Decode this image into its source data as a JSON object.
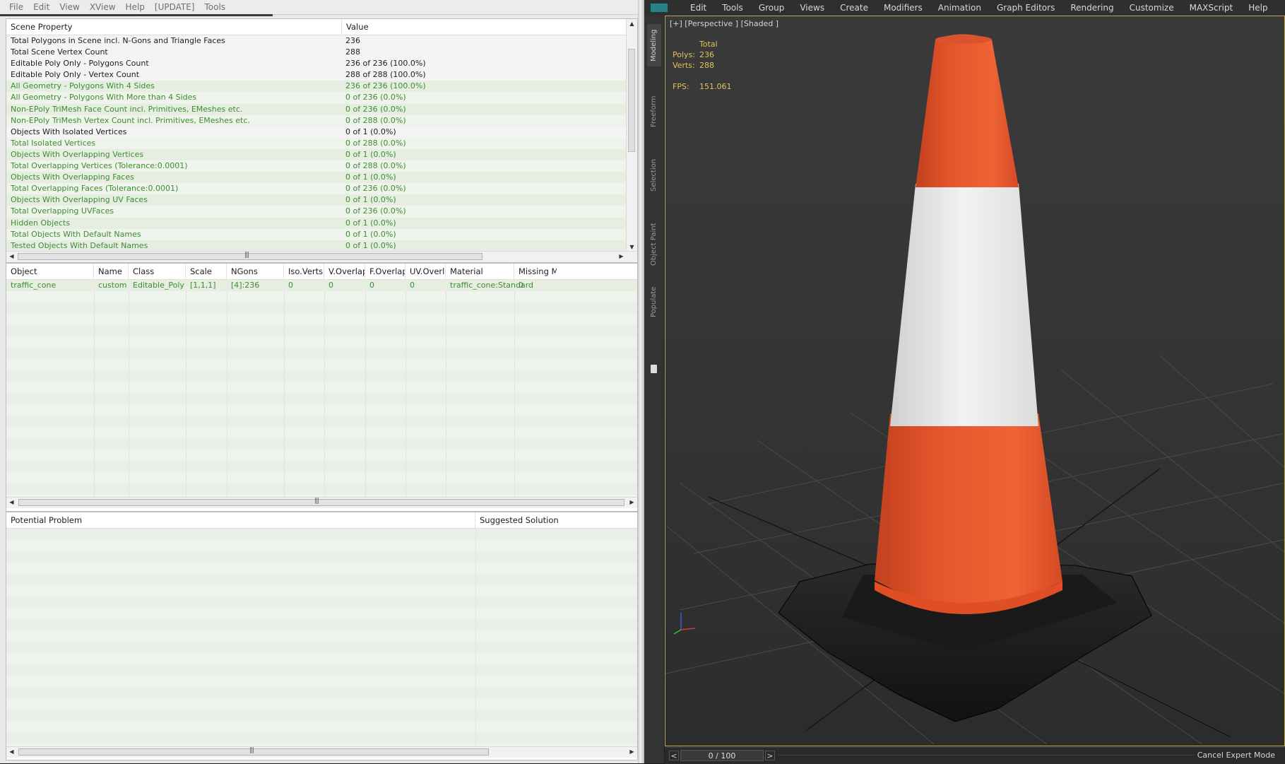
{
  "xview": {
    "menu": [
      "File",
      "Edit",
      "View",
      "XView",
      "Help",
      "[UPDATE]",
      "Tools"
    ],
    "scene_header": [
      "Scene Property",
      "Value"
    ],
    "scene_rows": [
      {
        "property": "Total Polygons in Scene incl. N-Gons and Triangle Faces",
        "value": "236",
        "status": "ok"
      },
      {
        "property": "Total Scene Vertex Count",
        "value": "288",
        "status": "ok"
      },
      {
        "property": "Editable Poly Only - Polygons Count",
        "value": "236 of 236 (100.0%)",
        "status": "ok"
      },
      {
        "property": "Editable Poly Only - Vertex Count",
        "value": "288 of 288 (100.0%)",
        "status": "ok"
      },
      {
        "property": "All Geometry - Polygons With 4 Sides",
        "value": "236 of 236 (100.0%)",
        "status": "warn"
      },
      {
        "property": "All Geometry - Polygons With More than 4 Sides",
        "value": "0 of 236 (0.0%)",
        "status": "warn"
      },
      {
        "property": "Non-EPoly TriMesh Face Count incl. Primitives, EMeshes etc.",
        "value": "0 of 236 (0.0%)",
        "status": "warn"
      },
      {
        "property": "Non-EPoly TriMesh Vertex Count incl. Primitives, EMeshes etc.",
        "value": "0 of 288 (0.0%)",
        "status": "warn"
      },
      {
        "property": "Objects With Isolated Vertices",
        "value": "0 of 1 (0.0%)",
        "status": "ok"
      },
      {
        "property": "Total Isolated Vertices",
        "value": "0 of 288 (0.0%)",
        "status": "warn"
      },
      {
        "property": "Objects With Overlapping Vertices",
        "value": "0 of 1 (0.0%)",
        "status": "warn"
      },
      {
        "property": "Total Overlapping Vertices (Tolerance:0.0001)",
        "value": "0 of 288 (0.0%)",
        "status": "warn"
      },
      {
        "property": "Objects With Overlapping Faces",
        "value": "0 of 1 (0.0%)",
        "status": "warn"
      },
      {
        "property": "Total Overlapping Faces (Tolerance:0.0001)",
        "value": "0 of 236 (0.0%)",
        "status": "warn"
      },
      {
        "property": "Objects With Overlapping UV Faces",
        "value": "0 of 1 (0.0%)",
        "status": "warn"
      },
      {
        "property": "Total Overlapping UVFaces",
        "value": "0 of 236 (0.0%)",
        "status": "warn"
      },
      {
        "property": "Hidden Objects",
        "value": "0 of 1 (0.0%)",
        "status": "warn"
      },
      {
        "property": "Total Objects With Default Names",
        "value": "0 of 1 (0.0%)",
        "status": "warn"
      },
      {
        "property": "Tested Objects With Default Names",
        "value": "0 of 1 (0.0%)",
        "status": "warn"
      }
    ],
    "object_header": [
      "Object",
      "Name",
      "Class",
      "Scale",
      "NGons",
      "Iso.Verts",
      "V.Overlap",
      "F.Overlap",
      "UV.Overlap",
      "Material",
      "Missing M..."
    ],
    "object_rows": [
      [
        "traffic_cone",
        "custom",
        "Editable_Poly",
        "[1,1,1]",
        "[4]:236",
        "0",
        "0",
        "0",
        "0",
        "traffic_cone:Standard",
        "0"
      ]
    ],
    "problem_header": [
      "Potential Problem",
      "Suggested Solution"
    ],
    "colors": {
      "ok_text": "#1e1e1e",
      "warn_text": "#3c8d2e",
      "row_green": "#e6eee2"
    }
  },
  "max": {
    "menu": [
      "Edit",
      "Tools",
      "Group",
      "Views",
      "Create",
      "Modifiers",
      "Animation",
      "Graph Editors",
      "Rendering",
      "Customize",
      "MAXScript",
      "Help"
    ],
    "ribbon_tabs": [
      "Modeling",
      "Freeform",
      "Selection",
      "Object Paint",
      "Populate"
    ],
    "viewport_label": "[+] [Perspective ] [Shaded ]",
    "stats": {
      "title": "Total",
      "polys_label": "Polys:",
      "polys": "236",
      "verts_label": "Verts:",
      "verts": "288",
      "fps_label": "FPS:",
      "fps": "151.061"
    },
    "timeline": {
      "prev": "<",
      "frame": "0 / 100",
      "next": ">"
    },
    "cancel_expert": "Cancel Expert Mode",
    "colors": {
      "cone_orange": "#e4542c",
      "cone_white": "#ececec",
      "base": "#1c1c1c",
      "stats_text": "#e1c35b",
      "viewport_border": "#bba74d"
    }
  }
}
